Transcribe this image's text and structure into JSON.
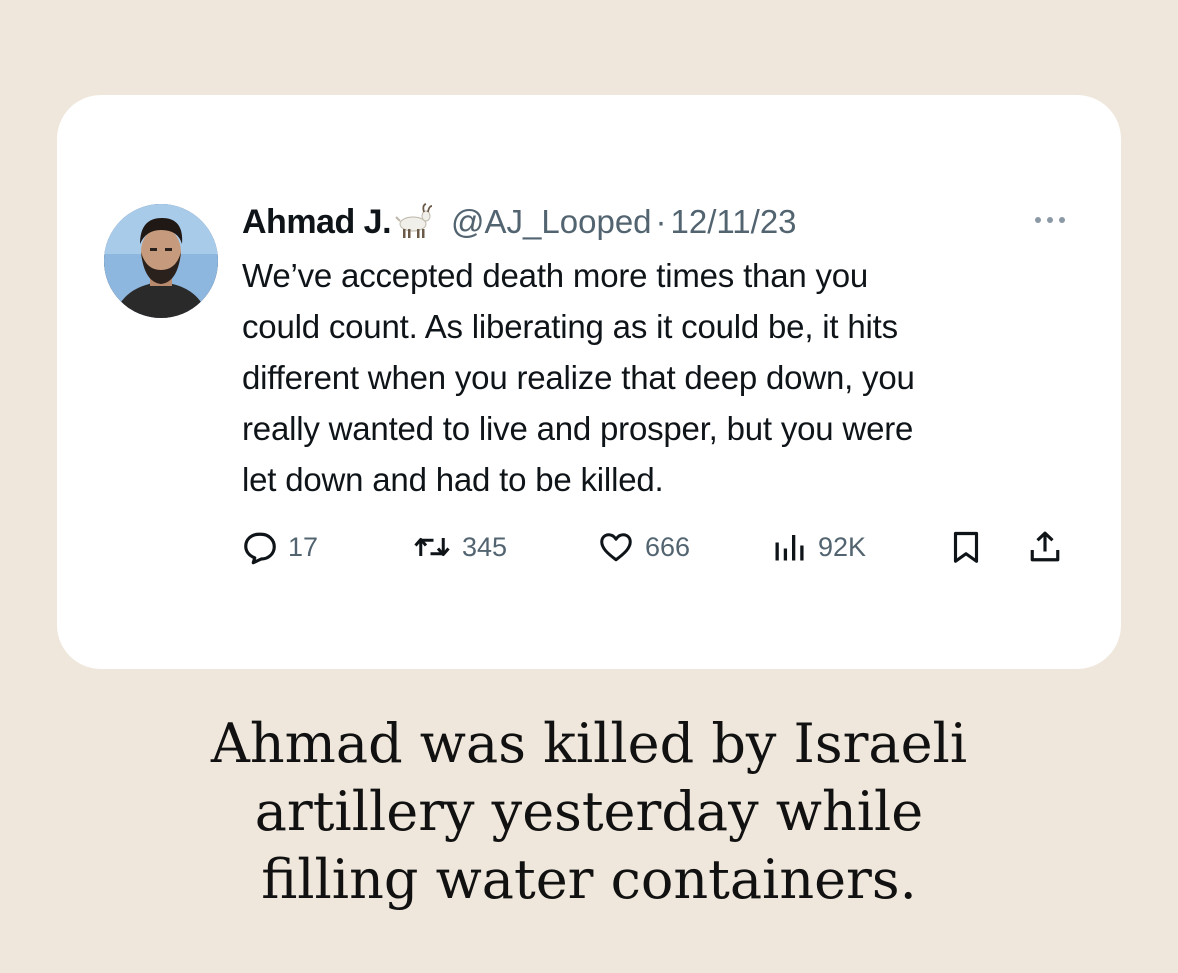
{
  "tweet": {
    "author_name": "Ahmad J.",
    "author_emoji_icon": "goat-icon",
    "handle": "@AJ_Looped",
    "separator": "·",
    "date": "12/11/23",
    "more_icon": "more-dots-icon",
    "text_lines": [
      "We’ve accepted death more times than you",
      "could count. As liberating as it could be, it hits",
      "different when you realize that deep down, you",
      "really wanted to live and prosper, but you were",
      "let down and had to be killed."
    ],
    "actions": {
      "replies": "17",
      "retweets": "345",
      "likes": "666",
      "views": "92K"
    }
  },
  "caption": {
    "lines": [
      "Ahmad was killed by Israeli",
      "artillery yesterday while",
      "filling water containers."
    ]
  },
  "colors": {
    "background": "#efe7dc",
    "card": "#ffffff",
    "text_primary": "#0f1419",
    "text_secondary": "#536471"
  }
}
